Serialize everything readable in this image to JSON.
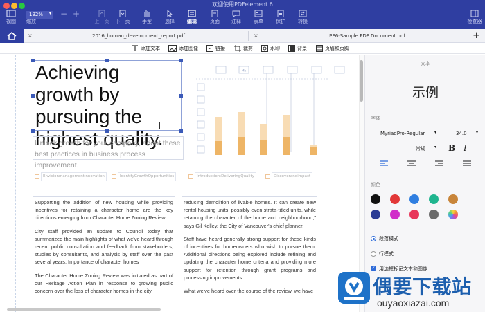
{
  "app": {
    "title": "欢迎使用PDFelement 6",
    "zoom": "192%",
    "zoom_out": "−",
    "zoom_in": "+"
  },
  "toolbar": {
    "items": [
      {
        "label": "视图",
        "icon": "view-icon"
      },
      {
        "label": "缩放",
        "icon": "zoom-icon"
      },
      {
        "label": "上一页",
        "icon": "prev-page-icon"
      },
      {
        "label": "下一页",
        "icon": "next-page-icon"
      },
      {
        "label": "手型",
        "icon": "hand-icon"
      },
      {
        "label": "选择",
        "icon": "select-icon"
      },
      {
        "label": "编辑",
        "icon": "edit-icon"
      },
      {
        "label": "页面",
        "icon": "page-icon"
      },
      {
        "label": "注释",
        "icon": "comment-icon"
      },
      {
        "label": "表单",
        "icon": "form-icon"
      },
      {
        "label": "保护",
        "icon": "protect-icon"
      },
      {
        "label": "转换",
        "icon": "convert-icon"
      },
      {
        "label": "检查器",
        "icon": "inspector-icon"
      }
    ]
  },
  "tabs": {
    "items": [
      {
        "label": "2016_human_development_report.pdf"
      },
      {
        "label": "PE6-Sample PDF Document.pdf"
      }
    ],
    "close": "×",
    "add": "+"
  },
  "editbar": {
    "items": [
      {
        "label": "添加文本",
        "icon": "add-text-icon"
      },
      {
        "label": "添加图像",
        "icon": "add-image-icon"
      },
      {
        "label": "链接",
        "icon": "link-icon"
      },
      {
        "label": "裁剪",
        "icon": "crop-icon"
      },
      {
        "label": "水印",
        "icon": "watermark-icon"
      },
      {
        "label": "背景",
        "icon": "background-icon"
      },
      {
        "label": "页眉和页脚",
        "icon": "header-footer-icon"
      }
    ]
  },
  "document": {
    "headline": "Achieving growth by pursuing the highest quality.",
    "subtitle": "Unlock growth for your company, adopt these best practices in business process improvement.",
    "chart_top_labels": [
      "",
      "Mk",
      "",
      "",
      "",
      "",
      ""
    ],
    "chart_axis_labels": [
      "",
      "",
      "",
      "",
      "",
      ""
    ],
    "chart_bars": [
      {
        "light": 0.55,
        "dark": 0.2
      },
      {
        "light": 0.62,
        "dark": 0.26
      },
      {
        "light": 0.45,
        "dark": 0.22
      },
      {
        "light": 0.58,
        "dark": 0.26
      },
      {
        "light": 0.15,
        "dark": 0.12
      }
    ],
    "tags": [
      "Envisionmanagementinnovation",
      "IdentifyGrowthOpportunities",
      "Introduction:DeliveringQuality",
      "Discoverandimpact"
    ],
    "col_left": [
      "Supporting the addition of new housing while providing incentives for retaining a character home are the key directions emerging from Character Home Zoning Review.",
      "City staff provided an update to Council today that summarized the main highlights of what we've heard through recent public consultation and feedback from stakeholders, studies by consultants, and analysis by staff over the past several years. Importance of character homes",
      "The Character Home Zoning Review was initiated as part of our Heritage Action Plan in response to growing public concern over the loss of character homes in the city"
    ],
    "col_right": [
      "reducing demolition of livable homes. It can create new rental housing units, possibly even strata-titled units, while retaining the character of the home and neighbourhood,\" says Gil Kelley, the City of Vancouver's chief planner.",
      "Staff have heard generally strong support for these kinds of incentives for homeowners who wish to pursue them. Additional directions being explored include refining and updating the character home criteria and providing more support for retention through grant programs and processing improvements.",
      "What we've heard over the course of the review, we have"
    ]
  },
  "panel": {
    "section_title": "文本",
    "preview": "示例",
    "font_label": "字体",
    "font_name": "MyriadPro-Regular",
    "font_size": "34.0",
    "font_style": "常规",
    "bold": "B",
    "italic": "I",
    "color_label": "颜色",
    "colors": [
      "#111111",
      "#e23838",
      "#2f7ee0",
      "#1fb58f",
      "#c8853a",
      "#2b3c95",
      "#d12fc9",
      "#e8365a",
      "#6b6b6b",
      "rainbow"
    ],
    "mode_paragraph": "段落模式",
    "mode_line": "行模式",
    "mark_label": "用边框标记文本和图像"
  },
  "watermark": {
    "title": "偶要下载站",
    "url": "ouyaoxiazai.com"
  }
}
